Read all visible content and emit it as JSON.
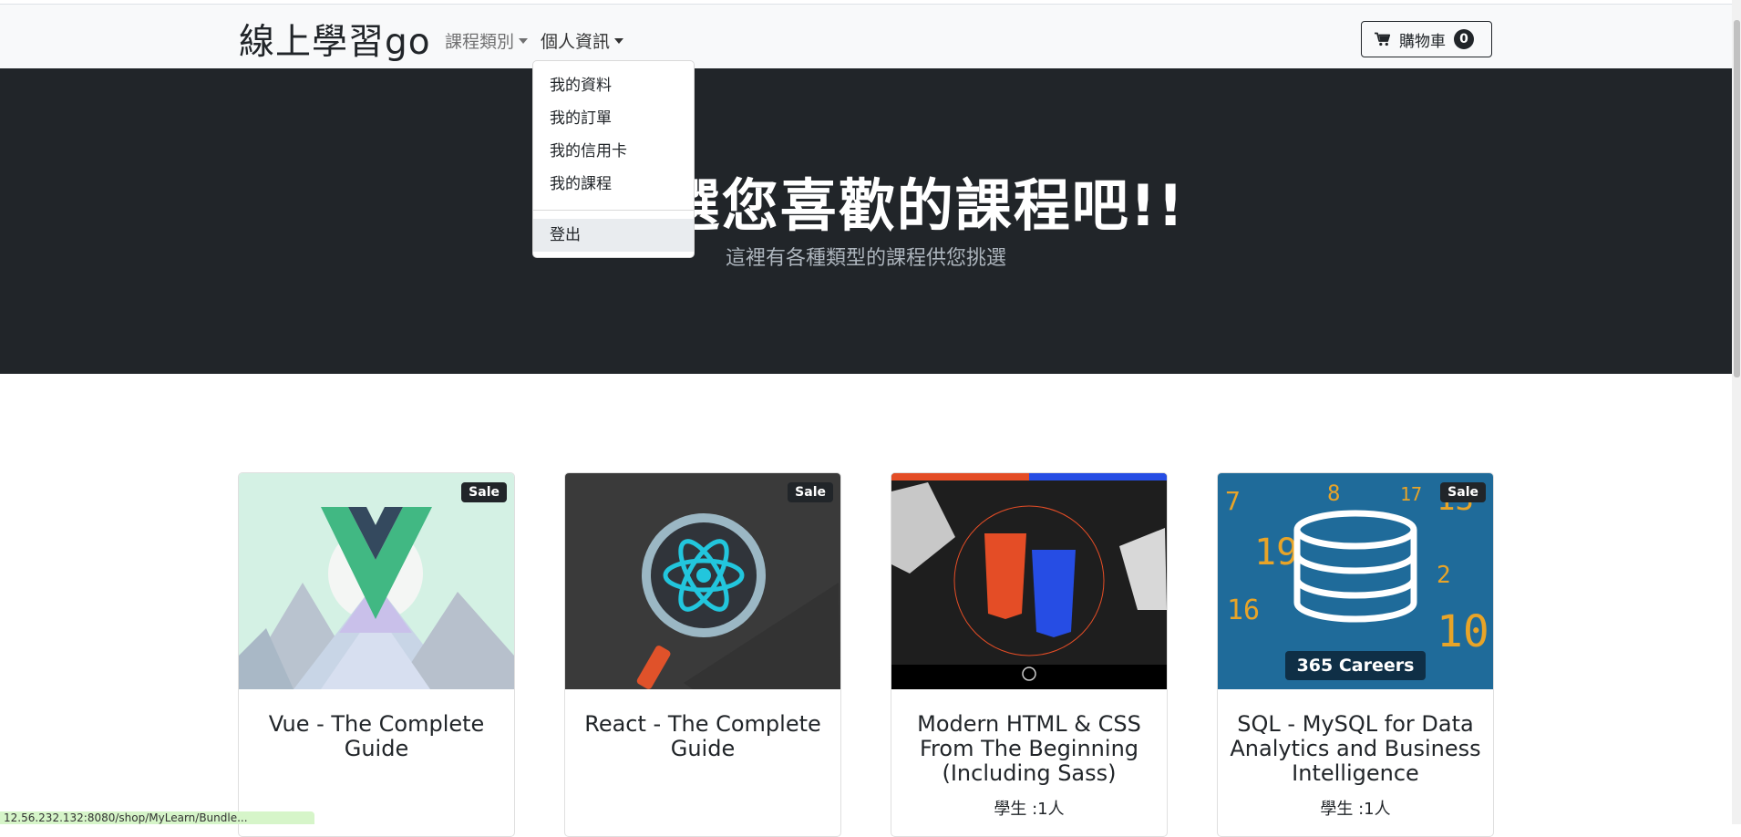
{
  "navbar": {
    "brand": "線上學習go",
    "nav_items": [
      {
        "label": "課程類別"
      },
      {
        "label": "個人資訊"
      }
    ],
    "cart": {
      "label": "購物車",
      "count": "0"
    }
  },
  "dropdown": {
    "items": [
      "我的資料",
      "我的訂單",
      "我的信用卡",
      "我的課程"
    ],
    "logout": "登出"
  },
  "hero": {
    "title": "請挑選您喜歡的課程吧!!",
    "subtitle": "這裡有各種類型的課程供您挑選"
  },
  "courses": [
    {
      "title": "Vue - The Complete Guide",
      "badge": "Sale",
      "students": ""
    },
    {
      "title": "React - The Complete Guide",
      "badge": "Sale",
      "students": ""
    },
    {
      "title": "Modern HTML & CSS From The Beginning (Including Sass)",
      "badge": "",
      "students": "學生 :1人"
    },
    {
      "title": "SQL - MySQL for Data Analytics and Business Intelligence",
      "badge": "Sale",
      "students": "學生 :1人"
    }
  ],
  "image_text": {
    "sql_logo": "365 Careers"
  },
  "statusbar": {
    "text": "12.56.232.132:8080/shop/MyLearn/Bundle..."
  }
}
